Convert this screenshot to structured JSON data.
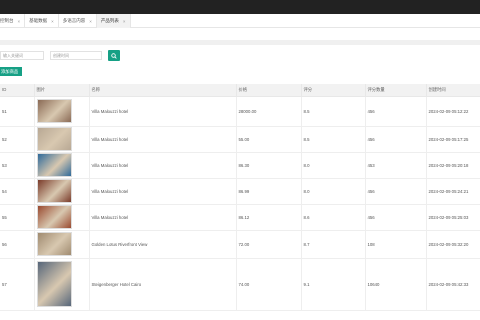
{
  "tabs": [
    {
      "label": "控制台"
    },
    {
      "label": "基础数据"
    },
    {
      "label": "多语言内容"
    },
    {
      "label": "产品列表"
    }
  ],
  "filters": {
    "name_placeholder": "输入关键词",
    "time_placeholder": "创建时间"
  },
  "toolbar": {
    "add_label": "添加商品"
  },
  "table": {
    "headers": [
      "ID",
      "图片",
      "名称",
      "价格",
      "评分",
      "评分数量",
      "创建时间"
    ],
    "rows": [
      {
        "id": "51",
        "name": "Villa Malouzzi hotel",
        "price": "28000.00",
        "rating": "8.5",
        "count": "456",
        "created": "2024-02-09 05:12:22",
        "img_color": "#8a6a55"
      },
      {
        "id": "52",
        "name": "Villa Malouzzi hotel",
        "price": "55.00",
        "rating": "8.5",
        "count": "456",
        "created": "2024-02-09 05:17:25",
        "img_color": "#b8a894"
      },
      {
        "id": "53",
        "name": "Villa Malouzzi hotel",
        "price": "86.30",
        "rating": "8.0",
        "count": "453",
        "created": "2024-02-09 05:20:18",
        "img_color": "#2f6a9a"
      },
      {
        "id": "54",
        "name": "Villa Malouzzi hotel",
        "price": "86.99",
        "rating": "8.0",
        "count": "456",
        "created": "2024-02-09 05:24:21",
        "img_color": "#7a3b2a"
      },
      {
        "id": "55",
        "name": "Villa Malouzzi hotel",
        "price": "86.12",
        "rating": "8.6",
        "count": "456",
        "created": "2024-02-09 05:25:03",
        "img_color": "#9a4a30"
      },
      {
        "id": "56",
        "name": "Golden Lotus Riverfront View",
        "price": "72.00",
        "rating": "8.7",
        "count": "108",
        "created": "2024-02-09 05:32:20",
        "img_color": "#a08b70"
      },
      {
        "id": "57",
        "name": "Steigenberger Hotel Cairo",
        "price": "74.00",
        "rating": "9.1",
        "count": "10640",
        "created": "2024-02-09 05:42:33",
        "img_color": "#56667a"
      }
    ]
  }
}
